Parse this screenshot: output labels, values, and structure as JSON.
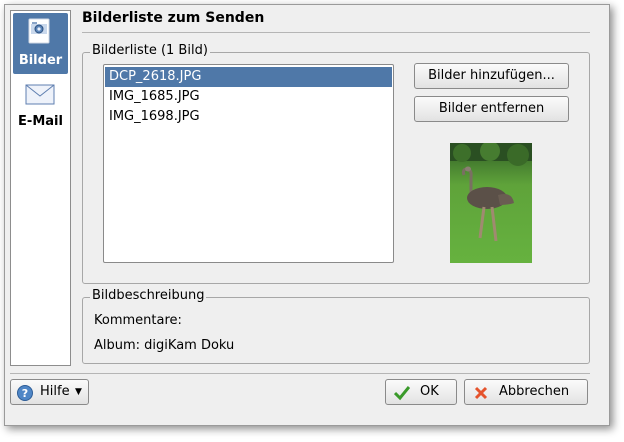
{
  "sidebar": {
    "items": [
      {
        "label": "Bilder",
        "icon": "image-settings-icon"
      },
      {
        "label": "E-Mail",
        "icon": "envelope-icon"
      }
    ]
  },
  "page_title": "Bilderliste zum Senden",
  "image_list": {
    "legend": "Bilderliste (1 Bild)",
    "items": [
      "DCP_2618.JPG",
      "IMG_1685.JPG",
      "IMG_1698.JPG"
    ],
    "selected": "DCP_2618.JPG"
  },
  "buttons": {
    "add": "Bilder hinzufügen...",
    "remove": "Bilder entfernen",
    "help": "Hilfe",
    "ok": "OK",
    "cancel": "Abbrechen"
  },
  "description": {
    "legend": "Bildbeschreibung",
    "comments": "Kommentare:",
    "album": "Album: digiKam Doku"
  },
  "colors": {
    "selection": "#4f78a8",
    "dialog_bg": "#efefef"
  }
}
